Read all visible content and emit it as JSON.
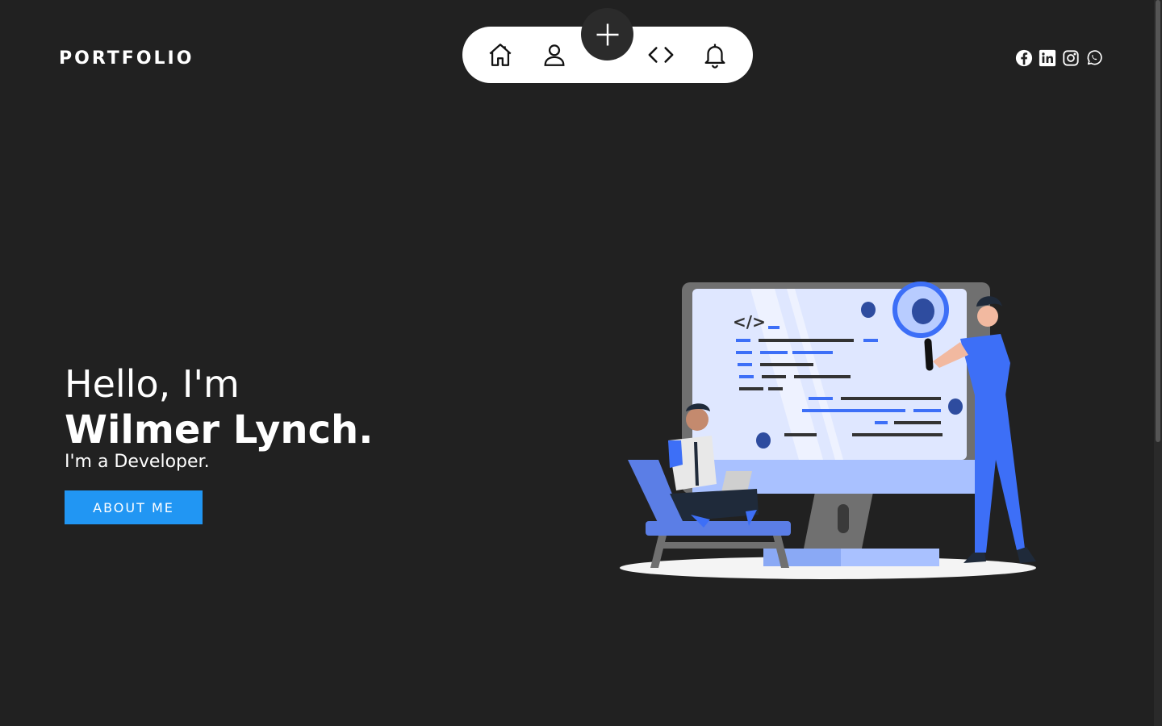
{
  "brand": {
    "title": "PORTFOLIO"
  },
  "nav": {
    "items": [
      {
        "name": "home",
        "icon": "home-icon"
      },
      {
        "name": "profile",
        "icon": "user-icon"
      },
      {
        "name": "add",
        "icon": "plus-icon"
      },
      {
        "name": "code",
        "icon": "code-icon"
      },
      {
        "name": "notifications",
        "icon": "bell-icon"
      }
    ]
  },
  "social": [
    "facebook-icon",
    "linkedin-icon",
    "instagram-icon",
    "whatsapp-icon"
  ],
  "hero": {
    "greeting": "Hello, I'm",
    "name": "Wilmer Lynch.",
    "role": "I'm a Developer.",
    "button_label": "ABOUT ME"
  },
  "illustration": {
    "code_tag": "</>",
    "icon": "developer-debugging-illustration"
  },
  "colors": {
    "background": "#212121",
    "accent": "#2196f3",
    "nav_bg": "#ffffff",
    "illustration_blue": "#3d6ff7"
  }
}
